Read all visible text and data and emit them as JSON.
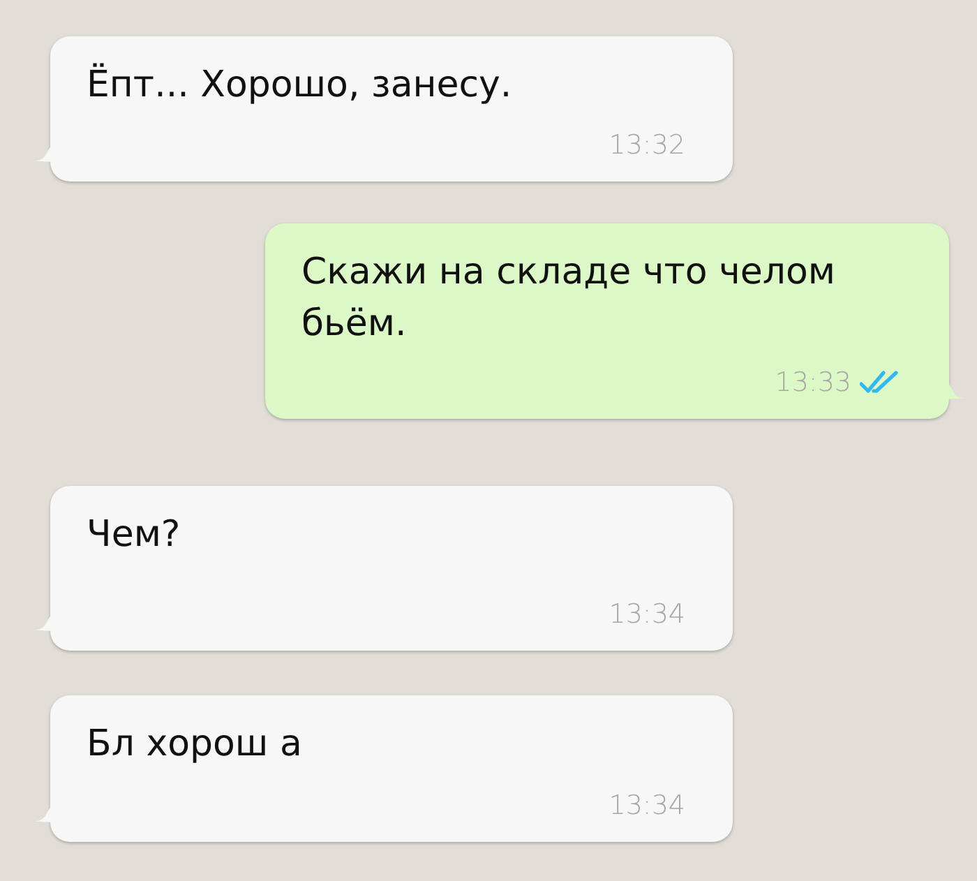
{
  "messages": [
    {
      "kind": "incoming",
      "text": "Ёпт... Хорошо, занесу.",
      "time": "13:32"
    },
    {
      "kind": "outgoing",
      "text": "Скажи на складе что челом бьём.",
      "time": "13:33",
      "read": true
    },
    {
      "kind": "incoming",
      "text": "Чем?",
      "time": "13:34"
    },
    {
      "kind": "incoming",
      "text": "Бл хорош а",
      "time": "13:34"
    }
  ]
}
